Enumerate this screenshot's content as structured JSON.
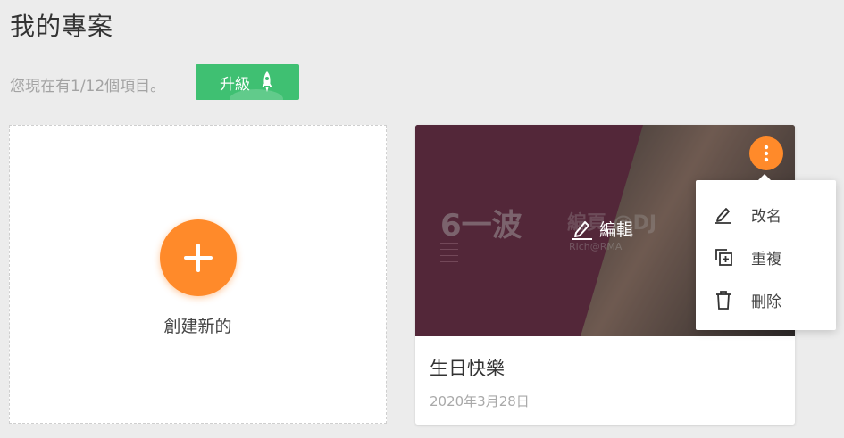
{
  "page": {
    "title": "我的專案",
    "quota_text": "您現在有1/12個項目。",
    "upgrade_label": "升級"
  },
  "create": {
    "label": "創建新的"
  },
  "project": {
    "name": "生日快樂",
    "date": "2020年3月28日",
    "edit_label": "編輯",
    "thumbnail": {
      "big_text": "6一波",
      "ghost_text": "編頁 @DJ",
      "ghost_sub": "Rich@RMA"
    }
  },
  "menu": {
    "items": [
      {
        "label": "改名",
        "icon": "pencil-icon"
      },
      {
        "label": "重複",
        "icon": "duplicate-icon"
      },
      {
        "label": "刪除",
        "icon": "trash-icon"
      }
    ]
  },
  "colors": {
    "accent_orange": "#ff8a2a",
    "upgrade_green": "#3fc072",
    "thumbnail_plum": "#7b3a54",
    "background": "#ececec"
  }
}
